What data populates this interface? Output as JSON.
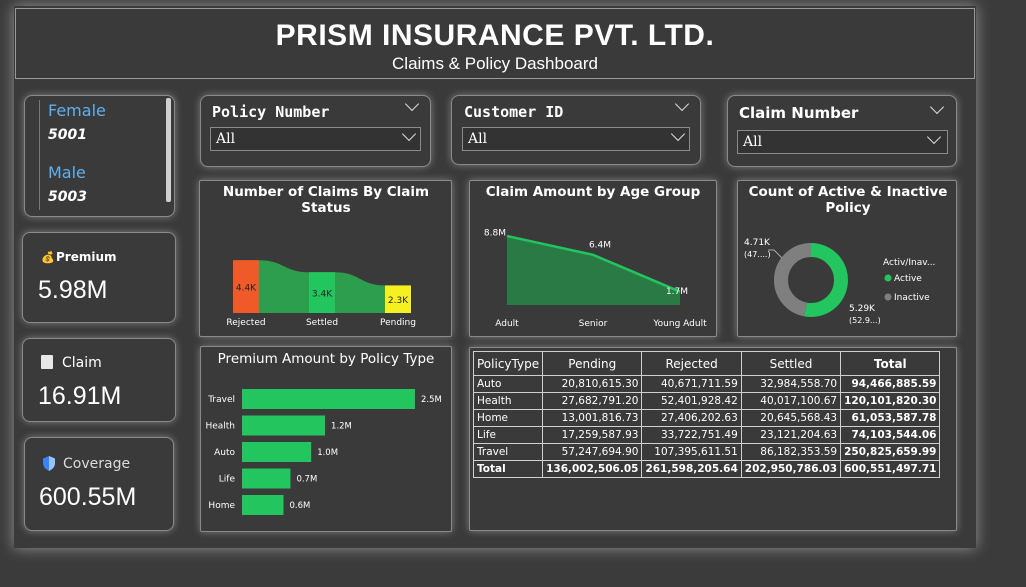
{
  "header": {
    "title": "PRISM INSURANCE PVT. LTD.",
    "subtitle": "Claims & Policy Dashboard"
  },
  "gender": [
    {
      "label": "Female",
      "value": "5001"
    },
    {
      "label": "Male",
      "value": "5003"
    }
  ],
  "kpis": {
    "premium": {
      "icon": "money-bag-icon",
      "label": "Premium",
      "value": "5.98M"
    },
    "claim": {
      "icon": "document-icon",
      "label": "Claim",
      "value": "16.91M"
    },
    "coverage": {
      "icon": "shield-icon",
      "label": "Coverage",
      "value": "600.55M"
    }
  },
  "slicers": {
    "policy_number": {
      "label": "Policy Number",
      "value": "All"
    },
    "customer_id": {
      "label": "Customer ID",
      "value": "All"
    },
    "claim_number": {
      "label": "Claim Number",
      "value": "All"
    }
  },
  "colors": {
    "accent_green": "#22c55e",
    "rejected": "#f05a28",
    "pending": "#f5f020",
    "inactive": "#7f7f7f",
    "gender_label": "#5fb0f0"
  },
  "chart_data": [
    {
      "type": "bar",
      "title": "Number of Claims By Claim Status",
      "categories": [
        "Rejected",
        "Settled",
        "Pending"
      ],
      "values": [
        4.4,
        3.4,
        2.3
      ],
      "data_labels": [
        "4.4K",
        "3.4K",
        "2.3K"
      ],
      "colors": [
        "#f05a28",
        "#22c55e",
        "#f5f020"
      ]
    },
    {
      "type": "area",
      "title": "Claim Amount by Age Group",
      "categories": [
        "Adult",
        "Senior",
        "Young Adult"
      ],
      "values": [
        8.8,
        6.4,
        1.7
      ],
      "data_labels": [
        "8.8M",
        "6.4M",
        "1.7M"
      ]
    },
    {
      "type": "pie",
      "title": "Count of Active & Inactive Policy",
      "legend_title": "Activ/Inav...",
      "slices": [
        {
          "name": "Active",
          "value": 5.29,
          "label": "5.29K",
          "pct_label": "(52.9...)",
          "color": "#22c55e"
        },
        {
          "name": "Inactive",
          "value": 4.71,
          "label": "4.71K",
          "pct_label": "(47....)",
          "color": "#7f7f7f"
        }
      ]
    },
    {
      "type": "bar",
      "orientation": "horizontal",
      "title": "Premium Amount by Policy Type",
      "categories": [
        "Travel",
        "Health",
        "Auto",
        "Life",
        "Home"
      ],
      "values": [
        2.5,
        1.2,
        1.0,
        0.7,
        0.6
      ],
      "data_labels": [
        "2.5M",
        "1.2M",
        "1.0M",
        "0.7M",
        "0.6M"
      ]
    },
    {
      "type": "table",
      "columns": [
        "PolicyType",
        "Pending",
        "Rejected",
        "Settled",
        "Total"
      ],
      "rows": [
        [
          "Auto",
          "20,810,615.30",
          "40,671,711.59",
          "32,984,558.70",
          "94,466,885.59"
        ],
        [
          "Health",
          "27,682,791.20",
          "52,401,928.42",
          "40,017,100.67",
          "120,101,820.30"
        ],
        [
          "Home",
          "13,001,816.73",
          "27,406,202.63",
          "20,645,568.43",
          "61,053,587.78"
        ],
        [
          "Life",
          "17,259,587.93",
          "33,722,751.49",
          "23,121,204.63",
          "74,103,544.06"
        ],
        [
          "Travel",
          "57,247,694.90",
          "107,395,611.51",
          "86,182,353.59",
          "250,825,659.99"
        ]
      ],
      "total": [
        "Total",
        "136,002,506.05",
        "261,598,205.64",
        "202,950,786.03",
        "600,551,497.71"
      ]
    }
  ]
}
